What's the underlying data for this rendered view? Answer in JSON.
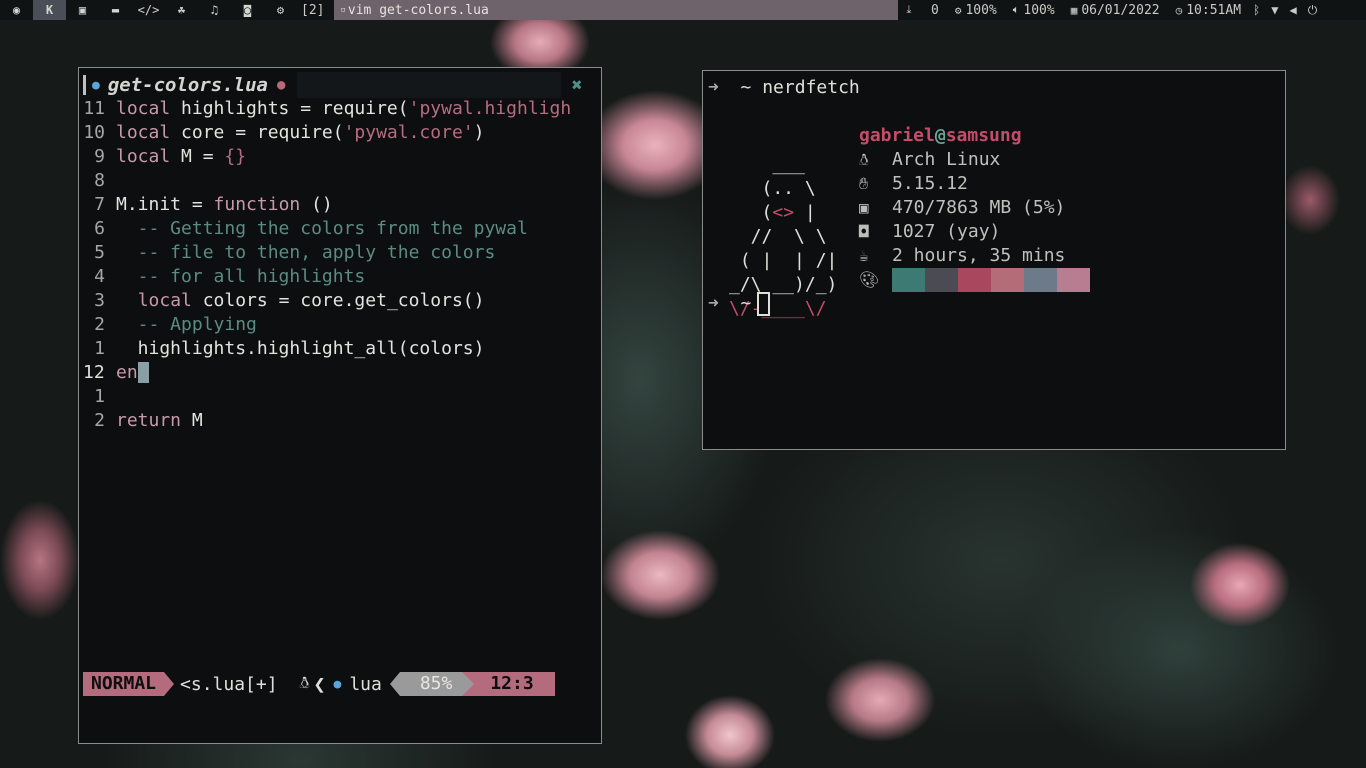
{
  "topbar": {
    "workspace_icons": [
      "arch-logo-icon",
      "k-icon",
      "terminal-icon",
      "folder-icon",
      "code-icon",
      "people-icon",
      "music-icon",
      "discord-icon",
      "gear-icon"
    ],
    "workspace_count": "[2]",
    "window_title": "vim get-colors.lua",
    "downloads": "0",
    "cpu": "100%",
    "volume": "100%",
    "date": "06/01/2022",
    "time": "10:51AM",
    "tray_icons": [
      "bluetooth-icon",
      "wifi-icon",
      "volume-icon",
      "power-icon"
    ]
  },
  "vim": {
    "tab": {
      "filename": "get-colors.lua",
      "modified_dot": "●",
      "close": "✖"
    },
    "lines": [
      {
        "num": "11",
        "parts": [
          [
            "kw",
            "local"
          ],
          [
            "txt",
            " highlights = require("
          ],
          [
            "str",
            "'pywal.highligh"
          ]
        ]
      },
      {
        "num": "10",
        "parts": [
          [
            "kw",
            "local"
          ],
          [
            "txt",
            " core = require("
          ],
          [
            "str",
            "'pywal.core'"
          ],
          [
            "txt",
            ")"
          ]
        ]
      },
      {
        "num": "9",
        "parts": [
          [
            "kw",
            "local"
          ],
          [
            "txt",
            " M = "
          ],
          [
            "str",
            "{}"
          ]
        ]
      },
      {
        "num": "8",
        "parts": []
      },
      {
        "num": "7",
        "parts": [
          [
            "txt",
            "M.init = "
          ],
          [
            "kw",
            "function"
          ],
          [
            "txt",
            " ()"
          ]
        ]
      },
      {
        "num": "6",
        "parts": [
          [
            "cm",
            "  -- Getting the colors from the pywal"
          ]
        ]
      },
      {
        "num": "5",
        "parts": [
          [
            "cm",
            "  -- file to then, apply the colors"
          ]
        ]
      },
      {
        "num": "4",
        "parts": [
          [
            "cm",
            "  -- for all highlights"
          ]
        ]
      },
      {
        "num": "3",
        "parts": [
          [
            "txt",
            "  "
          ],
          [
            "kw",
            "local"
          ],
          [
            "txt",
            " colors = core.get_colors()"
          ]
        ]
      },
      {
        "num": "2",
        "parts": [
          [
            "cm",
            "  -- Applying"
          ]
        ]
      },
      {
        "num": "1",
        "parts": [
          [
            "txt",
            "  highlights.highlight_all(colors)"
          ]
        ]
      },
      {
        "num": "12",
        "current": true,
        "parts": [
          [
            "kw",
            "en"
          ],
          [
            "cur",
            "d"
          ]
        ]
      },
      {
        "num": "1",
        "parts": []
      },
      {
        "num": "2",
        "parts": [
          [
            "kw",
            "return"
          ],
          [
            "txt",
            " M"
          ]
        ]
      }
    ],
    "status": {
      "mode": "NORMAL",
      "file": "<s.lua[+]",
      "os_icon": "linux-icon",
      "sep": "❮",
      "filetype": "lua",
      "percent": "85%",
      "position": "12:3"
    }
  },
  "terminal": {
    "prompt_arrow": "➜",
    "prompt_dir": "~",
    "command": "nerdfetch",
    "ascii": [
      "    ___",
      "   (.. \\",
      "   (<> |",
      "  //  \\ \\",
      " ( |  | /|",
      "_/\\ __)/_)",
      "\\/-____\\/"
    ],
    "info": {
      "user": "gabriel",
      "at": "@",
      "host": "samsung",
      "os": "Arch Linux",
      "kernel": "5.15.12",
      "memory": "470/7863 MB (5%)",
      "packages": "1027 (yay)",
      "uptime": "2 hours, 35 mins"
    },
    "palette": [
      "#3d7a74",
      "#4b4c53",
      "#a8475e",
      "#b46c78",
      "#6c7a89",
      "#b97d91"
    ]
  }
}
